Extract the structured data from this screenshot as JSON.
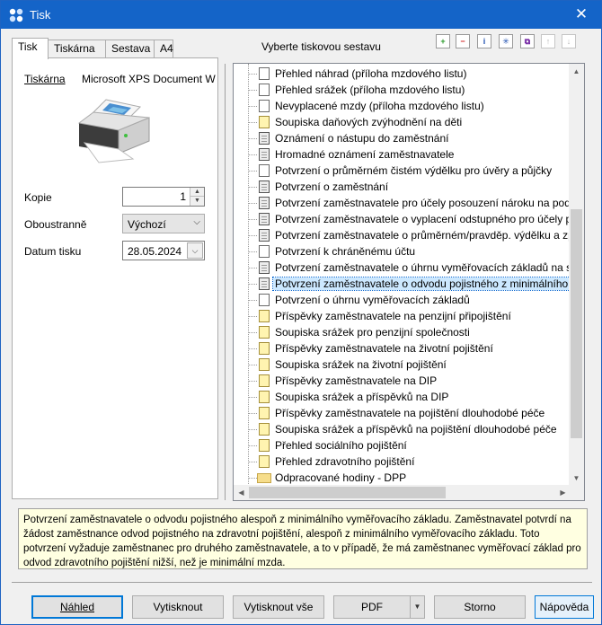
{
  "window": {
    "title": "Tisk",
    "close_glyph": "✕"
  },
  "tabs": [
    {
      "label": "Tisk",
      "active": true
    },
    {
      "label": "Tiskárna",
      "active": false
    },
    {
      "label": "Sestava",
      "active": false
    },
    {
      "label": "A4",
      "active": false
    }
  ],
  "print_tab": {
    "printer_label": "Tiskárna",
    "printer_name": "Microsoft XPS Document W",
    "copies_label": "Kopie",
    "copies_value": "1",
    "duplex_label": "Oboustranně",
    "duplex_value": "Výchozí",
    "date_label": "Datum tisku",
    "date_value": "28.05.2024"
  },
  "report_list": {
    "header": "Vyberte tiskovou sestavu",
    "toolbar_icons": [
      "add-icon",
      "remove-icon",
      "info-icon",
      "new-icon",
      "copy-icon",
      "move-up-icon",
      "move-down-icon"
    ],
    "items": [
      {
        "label": "Přehled náhrad (příloha mzdového listu)",
        "icon": "w"
      },
      {
        "label": "Přehled srážek (příloha mzdového listu)",
        "icon": "w"
      },
      {
        "label": "Nevyplacené mzdy (příloha mzdového listu)",
        "icon": "w"
      },
      {
        "label": "Soupiska daňových zvýhodnění na děti",
        "icon": "y"
      },
      {
        "label": "Oznámení o nástupu do zaměstnání",
        "icon": "d"
      },
      {
        "label": "Hromadné oznámení zaměstnavatele",
        "icon": "d"
      },
      {
        "label": "Potvrzení o průměrném čistém výdělku pro úvěry a půjčky",
        "icon": "w"
      },
      {
        "label": "Potvrzení o zaměstnání",
        "icon": "d"
      },
      {
        "label": "Potvrzení zaměstnavatele pro účely posouzení nároku na podp",
        "icon": "d"
      },
      {
        "label": "Potvrzení zaměstnavatele o vyplacení odstupného pro účely po",
        "icon": "d"
      },
      {
        "label": "Potvrzení zaměstnavatele o průměrném/pravděp. výdělku a zp",
        "icon": "d"
      },
      {
        "label": "Potvrzení k chráněnému účtu",
        "icon": "w"
      },
      {
        "label": "Potvrzení zaměstnavatele o úhrnu vyměřovacích základů na so",
        "icon": "d"
      },
      {
        "label": "Potvrzení zaměstnavatele o odvodu pojistného z minimálního",
        "icon": "d",
        "selected": true
      },
      {
        "label": "Potvrzení o úhrnu vyměřovacích základů",
        "icon": "w"
      },
      {
        "label": "Příspěvky zaměstnavatele na penzijní připojištění",
        "icon": "y"
      },
      {
        "label": "Soupiska srážek pro penzijní společnosti",
        "icon": "y"
      },
      {
        "label": "Příspěvky zaměstnavatele na životní pojištění",
        "icon": "y"
      },
      {
        "label": "Soupiska srážek na životní pojištění",
        "icon": "y"
      },
      {
        "label": "Příspěvky zaměstnavatele na DIP",
        "icon": "y"
      },
      {
        "label": "Soupiska srážek a příspěvků na DIP",
        "icon": "y"
      },
      {
        "label": "Příspěvky zaměstnavatele na pojištění dlouhodobé péče",
        "icon": "y"
      },
      {
        "label": "Soupiska srážek a příspěvků na pojištění dlouhodobé péče",
        "icon": "y"
      },
      {
        "label": "Přehled sociálního pojištění",
        "icon": "y"
      },
      {
        "label": "Přehled zdravotního pojištění",
        "icon": "y"
      },
      {
        "label": "Odpracované hodiny - DPP",
        "icon": "folder"
      }
    ]
  },
  "description": "Potvrzení zaměstnavatele o odvodu pojistného alespoň z minimálního vyměřovacího základu. Zaměstnavatel potvrdí na žádost zaměstnance odvod pojistného na zdravotní pojištění, alespoň z minimálního vyměřovacího základu. Toto potvrzení vyžaduje zaměstnanec pro druhého zaměstnavatele, a to v případě, že má zaměstnanec vyměřovací základ pro odvod zdravotního pojištění nižší, než je minimální mzda.",
  "buttons": {
    "preview": "Náhled",
    "print": "Vytisknout",
    "print_all": "Vytisknout vše",
    "pdf": "PDF",
    "cancel": "Storno",
    "help": "Nápověda"
  },
  "colors": {
    "accent": "#1464c8",
    "selection": "#cce8ff",
    "description_bg": "#ffffe1"
  }
}
